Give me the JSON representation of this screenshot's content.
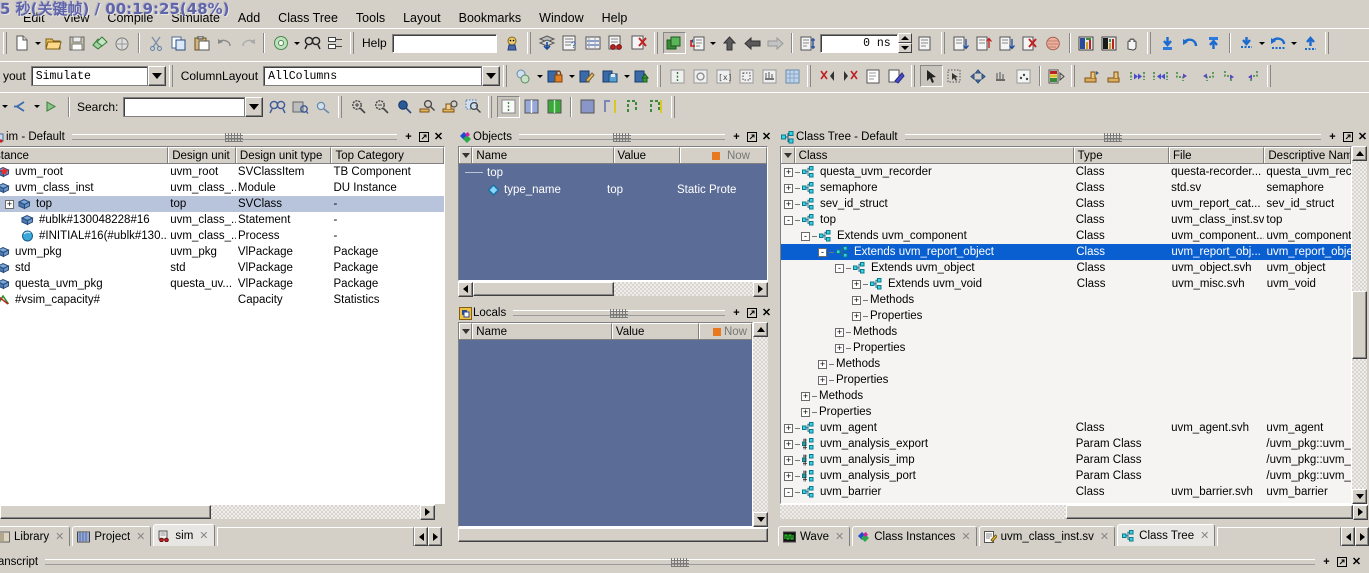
{
  "overlay": {
    "title": "5 秒(关键帧) / 00:19:25(48%)"
  },
  "menubar": {
    "items": [
      "Edit",
      "View",
      "Compile",
      "Simulate",
      "Add",
      "Class Tree",
      "Tools",
      "Layout",
      "Bookmarks",
      "Window",
      "Help"
    ]
  },
  "toolbar1": {
    "help_label": "Help",
    "help_value": "",
    "time_value": "0  ns"
  },
  "toolbar2": {
    "layout_label": "yout",
    "layout_value": "Simulate",
    "columnlayout_label": "ColumnLayout",
    "columnlayout_value": "AllColumns"
  },
  "toolbar3": {
    "search_label": "Search:",
    "search_value": "",
    "search_placeholder": ""
  },
  "sim_pane": {
    "title": "im - Default",
    "columns": [
      "stance",
      "Design unit",
      "Design unit type",
      "Top Category"
    ],
    "rows": [
      {
        "icon": "sv-class-item-icon",
        "indent": 0,
        "expander": "",
        "name": "uvm_root",
        "design_unit": "uvm_root",
        "du_type": "SVClassItem",
        "top_category": "TB Component",
        "selected": false
      },
      {
        "icon": "module-icon",
        "indent": 0,
        "expander": "",
        "name": "uvm_class_inst",
        "design_unit": "uvm_class_...",
        "du_type": "Module",
        "top_category": "DU Instance",
        "selected": false
      },
      {
        "icon": "module-icon",
        "indent": 1,
        "expander": "+",
        "name": "top",
        "design_unit": "top",
        "du_type": "SVClass",
        "top_category": "-",
        "selected": true
      },
      {
        "icon": "module-icon",
        "indent": 2,
        "expander": "",
        "name": "#ublk#130048228#16",
        "design_unit": "uvm_class_...",
        "du_type": "Statement",
        "top_category": "-",
        "selected": false
      },
      {
        "icon": "process-icon",
        "indent": 2,
        "expander": "",
        "name": "#INITIAL#16(#ublk#130...",
        "design_unit": "uvm_class_...",
        "du_type": "Process",
        "top_category": "-",
        "selected": false
      },
      {
        "icon": "module-icon",
        "indent": 0,
        "expander": "",
        "name": "uvm_pkg",
        "design_unit": "uvm_pkg",
        "du_type": "VlPackage",
        "top_category": "Package",
        "selected": false
      },
      {
        "icon": "module-icon",
        "indent": 0,
        "expander": "",
        "name": "std",
        "design_unit": "std",
        "du_type": "VlPackage",
        "top_category": "Package",
        "selected": false
      },
      {
        "icon": "module-icon",
        "indent": 0,
        "expander": "",
        "name": "questa_uvm_pkg",
        "design_unit": "questa_uv...",
        "du_type": "VlPackage",
        "top_category": "Package",
        "selected": false
      },
      {
        "icon": "capacity-icon",
        "indent": 0,
        "expander": "",
        "name": "#vsim_capacity#",
        "design_unit": "",
        "du_type": "Capacity",
        "top_category": "Statistics",
        "selected": false
      }
    ]
  },
  "objects_pane": {
    "title": "Objects",
    "columns": [
      "Name",
      "Value",
      "Now"
    ],
    "rows": [
      {
        "icon": "group-divider-icon",
        "indent": 0,
        "name": "top",
        "value": "",
        "kind": ""
      },
      {
        "icon": "diamond-icon",
        "indent": 1,
        "name": "type_name",
        "value": "top",
        "kind": "Static Prote"
      }
    ]
  },
  "locals_pane": {
    "title": "Locals",
    "columns": [
      "Name",
      "Value",
      "Now"
    ],
    "rows": []
  },
  "classtree_pane": {
    "title": "Class Tree - Default",
    "columns": [
      "Class",
      "Type",
      "File",
      "Descriptive Name"
    ],
    "rows": [
      {
        "indent": 0,
        "expander": "+",
        "icon": "class-icon",
        "name": "questa_uvm_recorder",
        "type": "Class",
        "file": "questa-recorder...",
        "desc": "questa_uvm_reco",
        "selected": false
      },
      {
        "indent": 0,
        "expander": "+",
        "icon": "class-icon",
        "name": "semaphore",
        "type": "Class",
        "file": "std.sv",
        "desc": "semaphore",
        "selected": false
      },
      {
        "indent": 0,
        "expander": "+",
        "icon": "class-icon",
        "name": "sev_id_struct",
        "type": "Class",
        "file": "uvm_report_cat...",
        "desc": "sev_id_struct",
        "selected": false
      },
      {
        "indent": 0,
        "expander": "-",
        "icon": "class-icon",
        "name": "top",
        "type": "Class",
        "file": "uvm_class_inst.sv",
        "desc": "top",
        "selected": false
      },
      {
        "indent": 1,
        "expander": "-",
        "icon": "class-icon",
        "name": "Extends  uvm_component",
        "type": "Class",
        "file": "uvm_component...",
        "desc": "uvm_component",
        "selected": false
      },
      {
        "indent": 2,
        "expander": "-",
        "icon": "class-icon",
        "name": "Extends  uvm_report_object",
        "type": "Class",
        "file": "uvm_report_obj...",
        "desc": "uvm_report_obje",
        "selected": true
      },
      {
        "indent": 3,
        "expander": "-",
        "icon": "class-icon",
        "name": "Extends  uvm_object",
        "type": "Class",
        "file": "uvm_object.svh",
        "desc": "uvm_object",
        "selected": false
      },
      {
        "indent": 4,
        "expander": "+",
        "icon": "class-icon",
        "name": "Extends  uvm_void",
        "type": "Class",
        "file": "uvm_misc.svh",
        "desc": "uvm_void",
        "selected": false
      },
      {
        "indent": 4,
        "expander": "+",
        "icon": "",
        "name": "Methods",
        "type": "",
        "file": "",
        "desc": "",
        "selected": false
      },
      {
        "indent": 4,
        "expander": "+",
        "icon": "",
        "name": "Properties",
        "type": "",
        "file": "",
        "desc": "",
        "selected": false
      },
      {
        "indent": 3,
        "expander": "+",
        "icon": "",
        "name": "Methods",
        "type": "",
        "file": "",
        "desc": "",
        "selected": false
      },
      {
        "indent": 3,
        "expander": "+",
        "icon": "",
        "name": "Properties",
        "type": "",
        "file": "",
        "desc": "",
        "selected": false
      },
      {
        "indent": 2,
        "expander": "+",
        "icon": "",
        "name": "Methods",
        "type": "",
        "file": "",
        "desc": "",
        "selected": false
      },
      {
        "indent": 2,
        "expander": "+",
        "icon": "",
        "name": "Properties",
        "type": "",
        "file": "",
        "desc": "",
        "selected": false
      },
      {
        "indent": 1,
        "expander": "+",
        "icon": "",
        "name": "Methods",
        "type": "",
        "file": "",
        "desc": "",
        "selected": false
      },
      {
        "indent": 1,
        "expander": "+",
        "icon": "",
        "name": "Properties",
        "type": "",
        "file": "",
        "desc": "",
        "selected": false
      },
      {
        "indent": 0,
        "expander": "+",
        "icon": "class-icon",
        "name": "uvm_agent",
        "type": "Class",
        "file": "uvm_agent.svh",
        "desc": "uvm_agent",
        "selected": false
      },
      {
        "indent": 0,
        "expander": "+",
        "icon": "param-class-icon",
        "name": "uvm_analysis_export",
        "type": "Param Class",
        "file": "",
        "desc": "/uvm_pkg::uvm_",
        "selected": false
      },
      {
        "indent": 0,
        "expander": "+",
        "icon": "param-class-icon",
        "name": "uvm_analysis_imp",
        "type": "Param Class",
        "file": "",
        "desc": "/uvm_pkg::uvm_",
        "selected": false
      },
      {
        "indent": 0,
        "expander": "+",
        "icon": "param-class-icon",
        "name": "uvm_analysis_port",
        "type": "Param Class",
        "file": "",
        "desc": "/uvm_pkg::uvm_",
        "selected": false
      },
      {
        "indent": 0,
        "expander": "-",
        "icon": "class-icon",
        "name": "uvm_barrier",
        "type": "Class",
        "file": "uvm_barrier.svh",
        "desc": "uvm_barrier",
        "selected": false
      }
    ]
  },
  "left_tabs": {
    "items": [
      {
        "label": "Library",
        "icon": "library-icon",
        "active": false
      },
      {
        "label": "Project",
        "icon": "project-icon",
        "active": false
      },
      {
        "label": "sim",
        "icon": "sim-icon",
        "active": true
      }
    ]
  },
  "right_tabs": {
    "items": [
      {
        "label": "Wave",
        "icon": "wave-icon",
        "active": false
      },
      {
        "label": "Class Instances",
        "icon": "objects-icon",
        "active": false
      },
      {
        "label": "uvm_class_inst.sv",
        "icon": "source-icon",
        "active": false
      },
      {
        "label": "Class Tree",
        "icon": "classtree-icon",
        "active": true
      }
    ]
  },
  "transcript_pane": {
    "title": "ranscript"
  },
  "colors": {
    "face": "#d4d0c8",
    "selection_blue": "#0a5fd0",
    "row_select_grey": "#b8c4dc",
    "objects_bg": "#5b6c96",
    "accent_cyan": "#35d4e8",
    "title_overlay": "#5a5fa8"
  }
}
